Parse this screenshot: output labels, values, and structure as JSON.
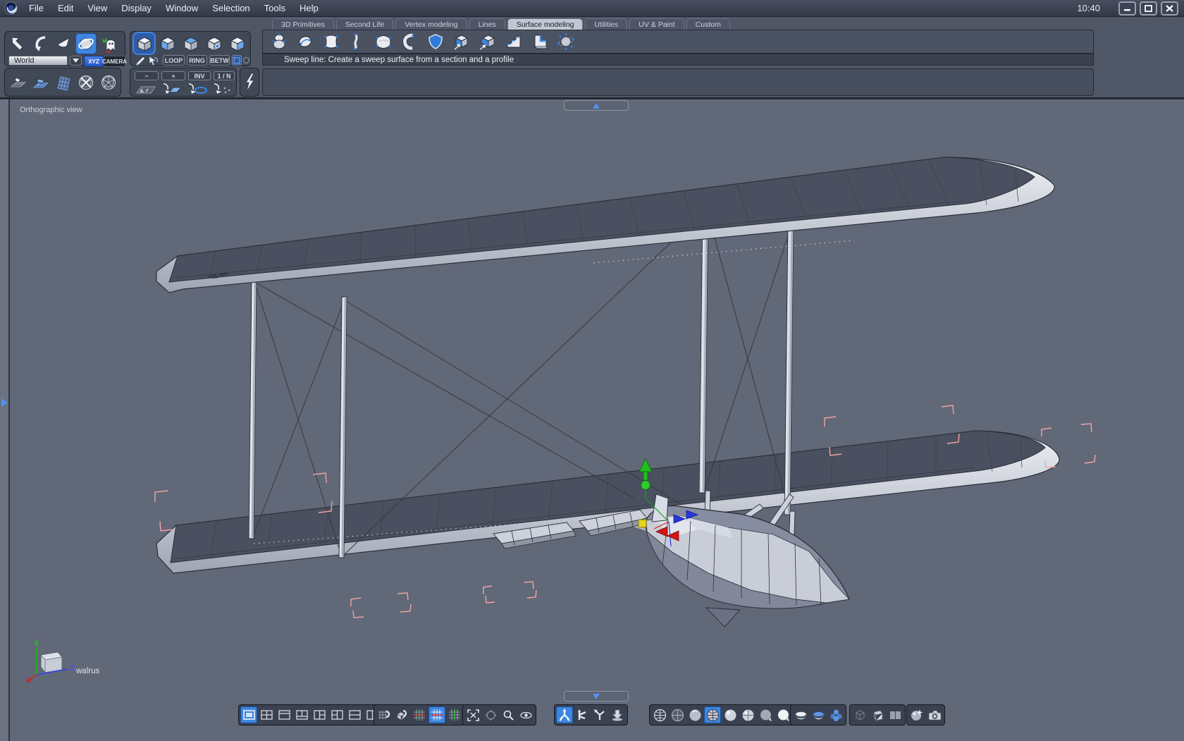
{
  "window": {
    "clock": "10:40",
    "controls": [
      "minimize",
      "maximize",
      "close"
    ]
  },
  "menubar": {
    "items": [
      "File",
      "Edit",
      "View",
      "Display",
      "Window",
      "Selection",
      "Tools",
      "Help"
    ]
  },
  "ribbon": {
    "tabs": [
      "3D Primitives",
      "Second Life",
      "Vertex modeling",
      "Lines",
      "Surface modeling",
      "Utilities",
      "UV & Paint",
      "Custom"
    ],
    "active_tab": "Surface modeling",
    "icons": [
      "lathe-object",
      "curve-capsule",
      "surface-four-points",
      "profile-curve",
      "coons-patch",
      "bent-tube",
      "ruled-surface",
      "extrude-face",
      "sweep-line",
      "stairs-sweep",
      "thickness-solid",
      "smooth-orbit"
    ]
  },
  "statusbar": {
    "text": "Sweep line: Create a sweep surface from a section and a profile"
  },
  "left_panel": {
    "row1_tools": [
      "undo-arrow",
      "redo-curve",
      "cone-tool",
      "sphere-manipulator",
      "ghost-dynamic"
    ],
    "world_selector": {
      "value": "World"
    },
    "coord_buttons": [
      {
        "label": "XYZ",
        "active": true
      },
      {
        "label": "CAMERA",
        "active": false
      }
    ],
    "cube_modes": [
      "object-mode",
      "face-mode",
      "edge-mode",
      "point-mode",
      "element-mode"
    ],
    "select_tools": [
      "paint-select",
      "arrow-select"
    ],
    "loop_buttons": [
      "LOOP",
      "RING",
      "BETW"
    ],
    "marquee_tools": [
      "rect-marquee",
      "circle-marquee"
    ],
    "row2_tools": [
      "ground-object",
      "ground-plane-blue",
      "grid-panel",
      "wire-sphere-x",
      "wire-sphere"
    ],
    "grow_buttons": [
      "−",
      "+",
      "INV",
      "1 / N"
    ],
    "grow_tools": [
      "select-grid",
      "select-face",
      "select-loop",
      "select-points"
    ],
    "dynamic_tool": "lightning-bolt"
  },
  "viewport": {
    "view_label": "Orthographic view",
    "object_label": "walrus",
    "background": "#616878",
    "selection_color": "#f0a5a3",
    "gizmo_colors": {
      "x": "#d31414",
      "y": "#23c023",
      "z": "#2637e0",
      "center": "#e6d31c"
    }
  },
  "bottom_bar": {
    "layout_group": [
      "single-view",
      "four-views",
      "split-top",
      "split-bottom",
      "one-left-two-right",
      "two-left-one-right",
      "two-rows",
      "two-columns"
    ],
    "layout_selected": "single-view",
    "snap_group": [
      "grid-magnet",
      "object-magnet",
      "symmetry-axes",
      "symmetry-x",
      "symmetry-z"
    ],
    "snap_selected": "symmetry-x",
    "nav_group": [
      "fit-view",
      "pan-view",
      "zoom-view",
      "orbit-view"
    ],
    "manipulator_group": [
      "universal-manipulator",
      "move-manipulator",
      "rotate-manipulator",
      "drop-manipulator"
    ],
    "manipulator_selected": "universal-manipulator",
    "shading_group": [
      "wireframe",
      "hidden-wire",
      "flat",
      "flat-wireframe",
      "smooth",
      "smooth-wireframe",
      "matte",
      "bright"
    ],
    "shading_selected": "flat-wireframe",
    "subdivision_group": [
      "hemisphere",
      "hemisphere-smooth",
      "sphere-cluster"
    ],
    "display_group": [
      "wire-cube",
      "tube",
      "double-panel"
    ],
    "render_group": [
      "material-sphere",
      "render-camera"
    ]
  }
}
